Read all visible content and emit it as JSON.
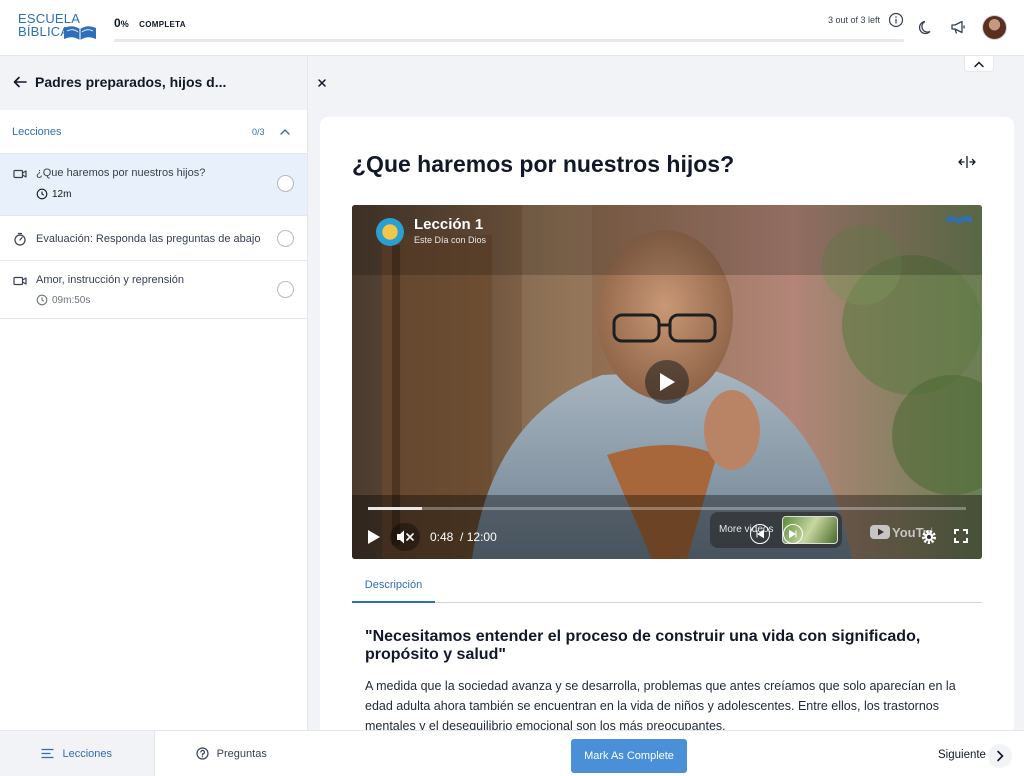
{
  "header": {
    "logo_line1": "ESCUELA",
    "logo_line2": "BÍBLICA",
    "progress_percent": "0",
    "progress_percent_sign": "%",
    "progress_label": "COMPLETA",
    "progress_fraction": 0,
    "remaining_text": "3 out of 3 left",
    "icons": [
      "info-icon",
      "moon-icon",
      "megaphone-icon",
      "avatar"
    ]
  },
  "sidebar": {
    "course_title": "Padres preparados, hijos d...",
    "section_label": "Lecciones",
    "section_count": "0/3",
    "lessons": [
      {
        "type": "video",
        "title": "¿Que haremos por nuestros hijos?",
        "duration": "12m",
        "active": true
      },
      {
        "type": "quiz",
        "title": "Evaluación: Responda las preguntas de abajo",
        "duration": ""
      },
      {
        "type": "video",
        "title": "Amor, instrucción y reprensión",
        "duration": "09m:50s"
      }
    ],
    "tabs": [
      {
        "label": "Lecciones",
        "active": true
      },
      {
        "label": "Preguntas",
        "active": false
      }
    ]
  },
  "main": {
    "title": "¿Que haremos por nuestros hijos?",
    "video": {
      "title": "Lección 1",
      "subtitle": "Este Día con Dios",
      "time_current": "0:48",
      "time_separator": "/",
      "time_total": "12:00",
      "played_fraction": 0.09,
      "more_videos_label": "More videos",
      "youtube_label": "YouTube"
    },
    "tabs": [
      {
        "label": "Descripción",
        "active": true
      }
    ],
    "description_heading": "\"Necesitamos entender el proceso de construir una vida con significado, propósito y salud\"",
    "description_body": "A medida que la sociedad avanza y se desarrolla, problemas que antes creíamos que solo aparecían en la edad adulta ahora también se encuentran en la vida de niños y adolescentes. Entre ellos, los trastornos mentales y el desequilibrio emocional son los más preocupantes."
  },
  "footer": {
    "complete_button": "Mark As Complete",
    "next_label": "Siguiente"
  },
  "colors": {
    "accent": "#2f6fb7",
    "button": "#4a90d9",
    "active_lesson_bg": "#e8f0fb"
  }
}
